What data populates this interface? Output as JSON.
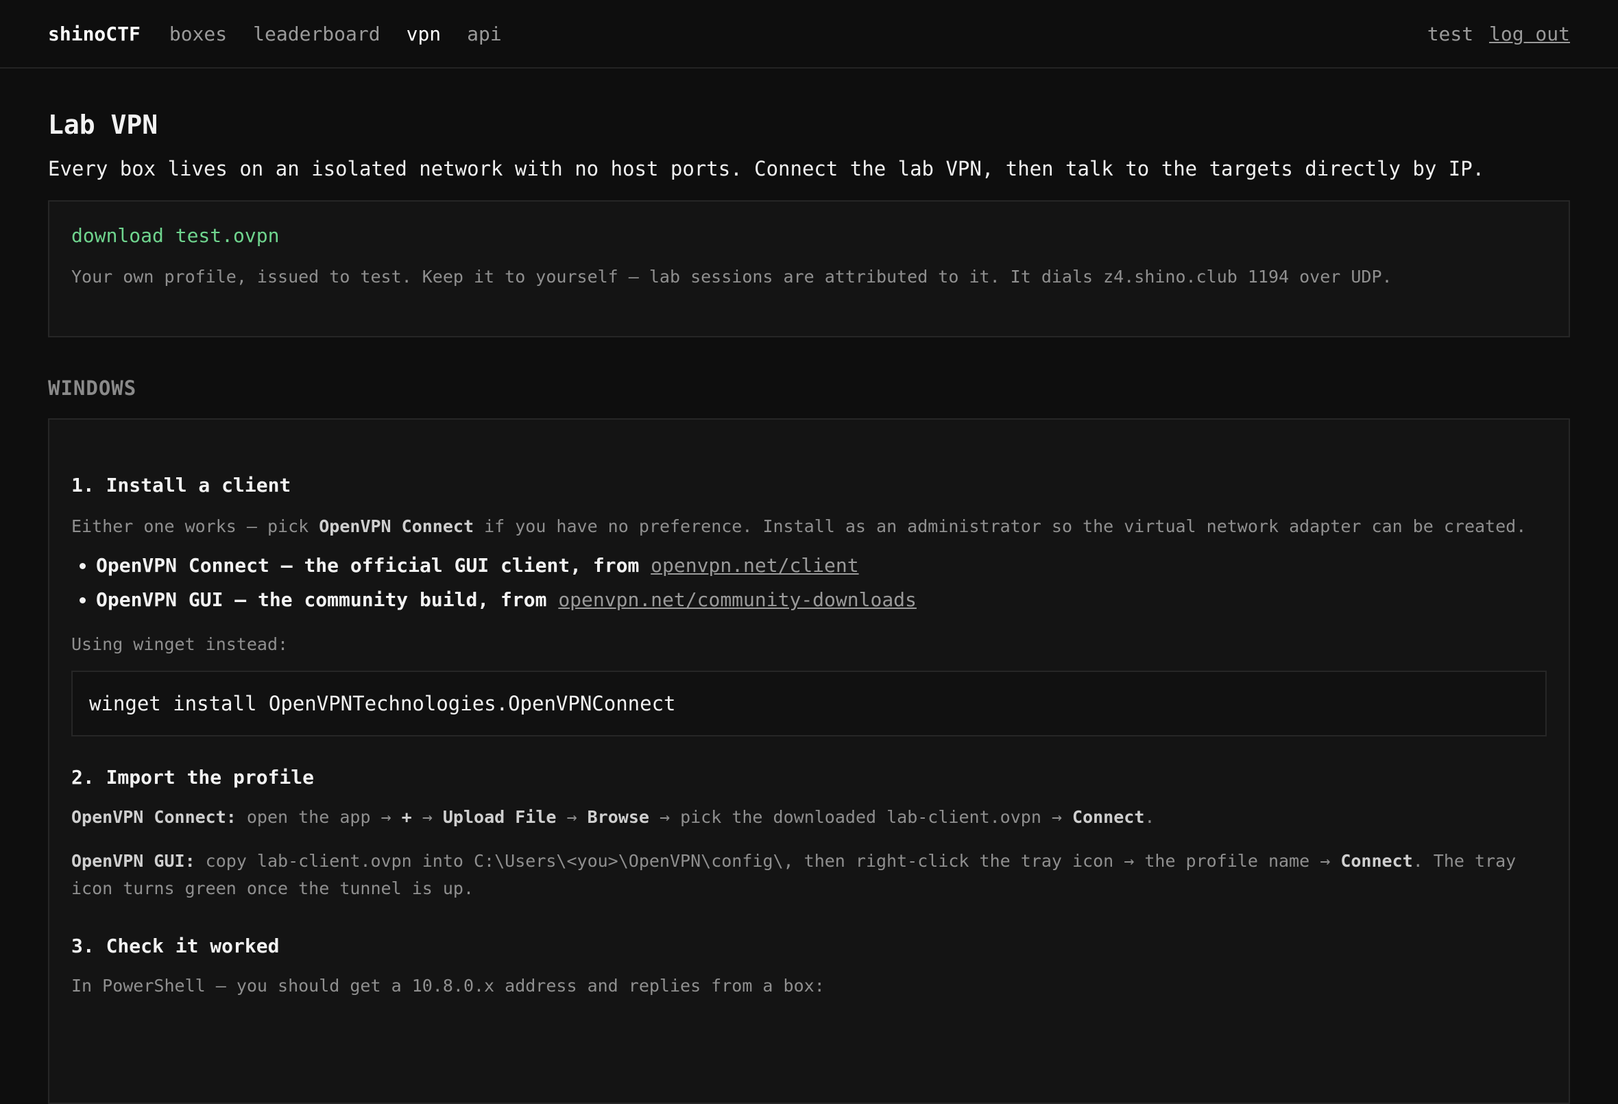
{
  "nav": {
    "brand": "shinoCTF",
    "links": [
      "boxes",
      "leaderboard",
      "vpn",
      "api"
    ],
    "active": "vpn",
    "username": "test",
    "logout": "log out"
  },
  "page": {
    "title": "Lab VPN",
    "lead": "Every box lives on an isolated network with no host ports. Connect the lab VPN, then talk to the targets directly by IP."
  },
  "download": {
    "link_label": "download test.ovpn",
    "note": "Your own profile, issued to test. Keep it to yourself — lab sessions are attributed to it. It dials z4.shino.club 1194 over UDP.",
    "link_color": "#6fd48e"
  },
  "windows": {
    "heading": "WINDOWS",
    "step1": {
      "title": "1. Install a client",
      "desc_before": "Either one works — pick ",
      "desc_bold": "OpenVPN Connect",
      "desc_after": " if you have no preference. Install as an administrator so the virtual network adapter can be created.",
      "clients": [
        {
          "name": "OpenVPN Connect",
          "desc": " — the official GUI client, from ",
          "url": "openvpn.net/client"
        },
        {
          "name": "OpenVPN GUI",
          "desc": " — the community build, from ",
          "url": "openvpn.net/community-downloads"
        }
      ],
      "winget_label": "Using winget instead:",
      "winget_cmd": "winget install OpenVPNTechnologies.OpenVPNConnect"
    },
    "step2": {
      "title": "2. Import the profile",
      "connect_label": "OpenVPN Connect:",
      "connect_1": " open the app → ",
      "connect_plus": "+",
      "connect_2": " → ",
      "connect_upload": "Upload File",
      "connect_3": " → ",
      "connect_browse": "Browse",
      "connect_4": " → pick the downloaded lab-client.ovpn → ",
      "connect_connect": "Connect",
      "connect_5": ".",
      "gui_label": "OpenVPN GUI:",
      "gui_1": " copy lab-client.ovpn into C:\\Users\\<you>\\OpenVPN\\config\\, then right-click the tray icon → the profile name → ",
      "gui_connect": "Connect",
      "gui_2": ". The tray icon turns green once the tunnel is up."
    },
    "step3": {
      "title": "3. Check it worked",
      "desc": "In PowerShell — you should get a 10.8.0.x address and replies from a box:"
    }
  }
}
